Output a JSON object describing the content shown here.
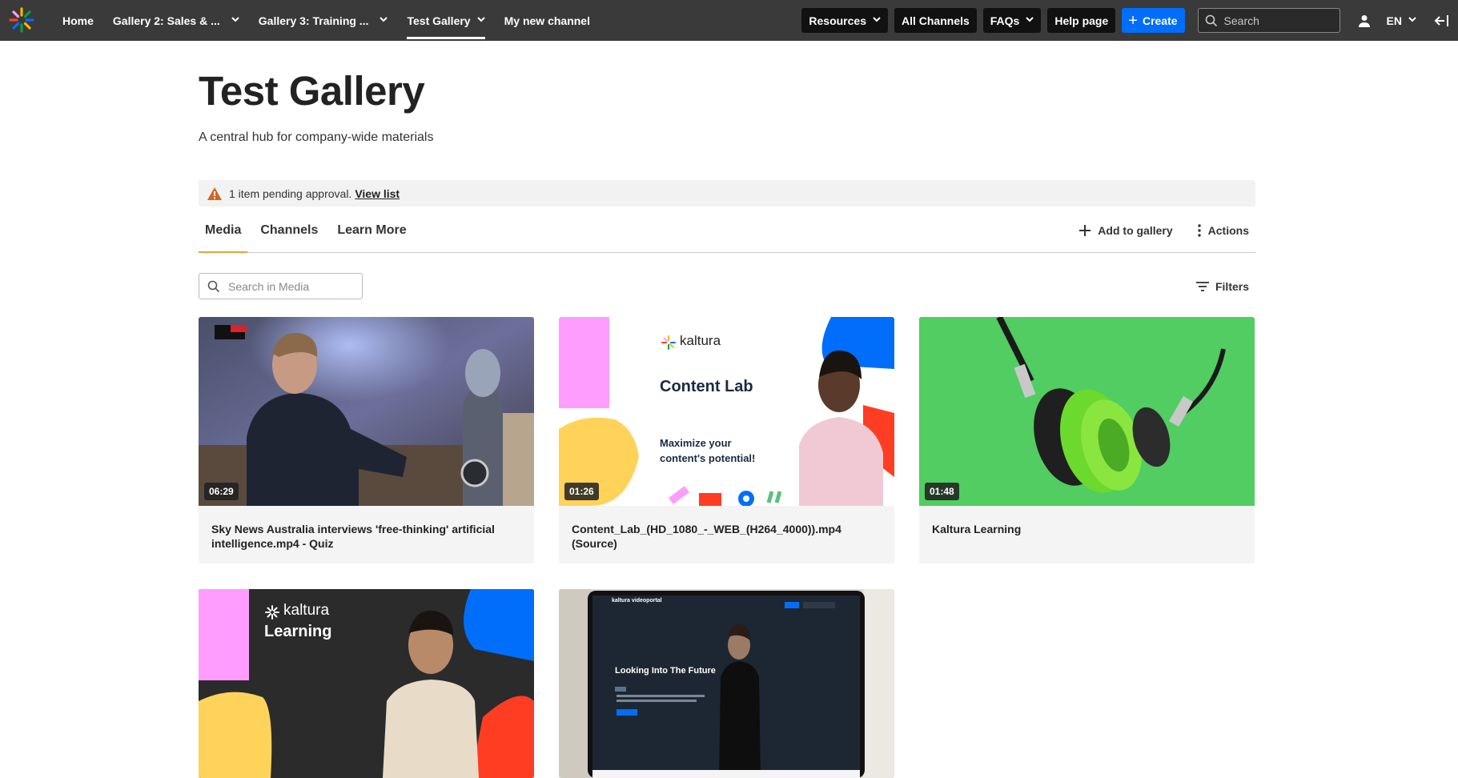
{
  "topnav": {
    "items": [
      {
        "label": "Home",
        "has_dropdown": false,
        "active": false
      },
      {
        "label": "Gallery 2: Sales & ...",
        "has_dropdown": true,
        "active": false
      },
      {
        "label": "Gallery 3: Training ...",
        "has_dropdown": true,
        "active": false
      },
      {
        "label": "Test Gallery",
        "has_dropdown": true,
        "active": true
      },
      {
        "label": "My new channel",
        "has_dropdown": false,
        "active": false
      }
    ],
    "resources_label": "Resources",
    "all_channels_label": "All Channels",
    "faqs_label": "FAQs",
    "help_label": "Help page",
    "create_label": "Create",
    "search_placeholder": "Search",
    "language": "EN"
  },
  "page": {
    "title": "Test Gallery",
    "description": "A central hub for company-wide materials"
  },
  "pending": {
    "text": "1 item pending approval.",
    "link": "View list"
  },
  "tabs": {
    "media": "Media",
    "channels": "Channels",
    "learn_more": "Learn More",
    "add_to_gallery": "Add to gallery",
    "actions": "Actions"
  },
  "filters": {
    "search_placeholder": "Search in Media",
    "filters_label": "Filters"
  },
  "media": [
    {
      "title": "Sky News Australia interviews 'free-thinking' artificial intelligence.mp4 - Quiz",
      "duration": "06:29"
    },
    {
      "title": "Content_Lab_(HD_1080_-_WEB_(H264_4000)).mp4 (Source)",
      "duration": "01:26",
      "thumb_brand": "kaltura",
      "thumb_heading": "Content Lab",
      "thumb_tagline": "Maximize your content's potential!"
    },
    {
      "title": "Kaltura Learning",
      "duration": "01:48"
    },
    {
      "title": "",
      "duration": "",
      "thumb_brand": "kaltura",
      "thumb_heading": "Learning"
    },
    {
      "title": "",
      "duration": "",
      "thumb_brand": "kaltura videoportal",
      "thumb_heading": "Looking Into The Future"
    }
  ],
  "colors": {
    "navbar": "#3a3a3a",
    "accent_blue": "#006efa",
    "tab_underline": "#e8a33a",
    "warning": "#d4651f"
  }
}
